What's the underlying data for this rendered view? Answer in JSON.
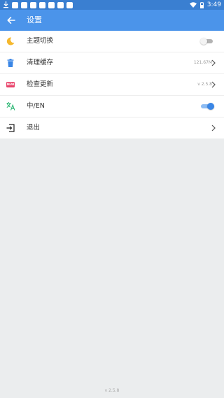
{
  "status_bar": {
    "time": "3:49",
    "icons": [
      "download-icon",
      "notification-icon",
      "wifi-icon",
      "battery-icon"
    ]
  },
  "app_bar": {
    "title": "设置",
    "back_icon": "arrow-left-icon"
  },
  "settings": [
    {
      "key": "theme",
      "label": "主题切换",
      "icon": "moon-icon",
      "icon_color": "#f5b82e",
      "control": "toggle",
      "toggle_state": "off"
    },
    {
      "key": "clear_cache",
      "label": "清理缓存",
      "icon": "trash-icon",
      "icon_color": "#3a86e6",
      "control": "chevron",
      "value": "121.67M"
    },
    {
      "key": "check_update",
      "label": "检查更新",
      "icon": "new-badge-icon",
      "icon_text": "NEW",
      "icon_color": "#e8436a",
      "control": "chevron",
      "value": "v 2.5.8"
    },
    {
      "key": "language",
      "label": "中/EN",
      "icon": "translate-icon",
      "icon_color": "#2bb673",
      "control": "toggle",
      "toggle_state": "on"
    },
    {
      "key": "logout",
      "label": "退出",
      "icon": "logout-icon",
      "icon_color": "#222222",
      "control": "chevron"
    }
  ],
  "footer": {
    "version": "v 2.5.8"
  },
  "colors": {
    "status_bar": "#3a7fd1",
    "app_bar": "#4b94ea",
    "background": "#ebedee",
    "toggle_on": "#3a86e6"
  }
}
